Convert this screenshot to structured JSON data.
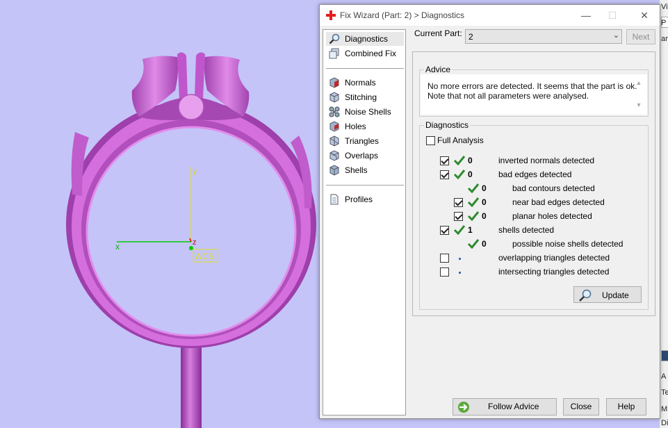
{
  "viewport": {
    "axis_x": "x",
    "axis_y": "y",
    "axis_z": "z",
    "wcs_label": "WCS",
    "colors": {
      "background": "#c4c4f8",
      "ring": "#d070d8",
      "ring_dark": "#9a3aa5",
      "axis_x": "#00cc00",
      "axis_y": "#e0e020",
      "axis_z": "#e00000"
    }
  },
  "edge_panel": {
    "labels": [
      "Vie",
      "P",
      "art",
      "A",
      "Tex",
      "M",
      "Dista"
    ]
  },
  "dialog": {
    "title": "Fix Wizard (Part: 2) > Diagnostics",
    "window_controls": {
      "minimize": "—",
      "maximize": "☐",
      "close": "✕"
    },
    "nav": {
      "items": [
        {
          "label": "Diagnostics",
          "icon": "magnifier-icon",
          "selected": true
        },
        {
          "label": "Combined Fix",
          "icon": "combined-fix-icon"
        },
        {
          "label": "Normals",
          "icon": "normals-cube-icon"
        },
        {
          "label": "Stitching",
          "icon": "stitching-cube-icon"
        },
        {
          "label": "Noise Shells",
          "icon": "noise-shells-icon"
        },
        {
          "label": "Holes",
          "icon": "holes-cube-icon"
        },
        {
          "label": "Triangles",
          "icon": "triangles-cube-icon"
        },
        {
          "label": "Overlaps",
          "icon": "overlaps-cube-icon"
        },
        {
          "label": "Shells",
          "icon": "shells-cube-icon"
        },
        {
          "label": "Profiles",
          "icon": "document-icon"
        }
      ]
    },
    "current_part": {
      "label": "Current Part:",
      "value": "2"
    },
    "next_label": "Next",
    "advice": {
      "title": "Advice",
      "line1": "No more errors are detected. It seems that the part is ok.",
      "line2": "Note that not all parameters were analysed."
    },
    "diagnostics": {
      "title": "Diagnostics",
      "full_analysis": {
        "label": "Full Analysis",
        "checked": false
      },
      "rows": [
        {
          "checkbox": true,
          "checked": true,
          "status": "ok",
          "count": "0",
          "label": "inverted normals detected",
          "indent": 0
        },
        {
          "checkbox": true,
          "checked": true,
          "status": "ok",
          "count": "0",
          "label": "bad edges detected",
          "indent": 0
        },
        {
          "checkbox": false,
          "checked": false,
          "status": "ok",
          "count": "0",
          "label": "bad contours detected",
          "indent": 2
        },
        {
          "checkbox": true,
          "checked": true,
          "status": "ok",
          "count": "0",
          "label": "near bad edges detected",
          "indent": 1
        },
        {
          "checkbox": true,
          "checked": true,
          "status": "ok",
          "count": "0",
          "label": "planar holes detected",
          "indent": 1
        },
        {
          "checkbox": true,
          "checked": true,
          "status": "ok",
          "count": "1",
          "label": "shells detected",
          "indent": 0
        },
        {
          "checkbox": false,
          "checked": false,
          "status": "ok",
          "count": "0",
          "label": "possible noise shells detected",
          "indent": 2
        },
        {
          "checkbox": true,
          "checked": false,
          "status": "none",
          "count": "",
          "label": "overlapping triangles detected",
          "indent": 0
        },
        {
          "checkbox": true,
          "checked": false,
          "status": "none",
          "count": "",
          "label": "intersecting triangles detected",
          "indent": 0
        }
      ],
      "update_label": "Update"
    },
    "buttons": {
      "follow_advice": "Follow Advice",
      "close": "Close",
      "help": "Help"
    },
    "colors": {
      "check_green": "#2e8b2e",
      "title_icon_red": "#e02020"
    }
  }
}
